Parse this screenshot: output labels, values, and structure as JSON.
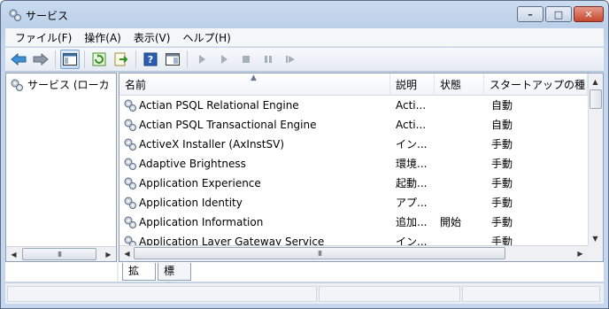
{
  "window": {
    "title": "サービス",
    "buttons": {
      "minimize": "–",
      "maximize": "□",
      "close": "✕"
    }
  },
  "menu": [
    {
      "label": "ファイル(F)"
    },
    {
      "label": "操作(A)"
    },
    {
      "label": "表示(V)"
    },
    {
      "label": "ヘルプ(H)"
    }
  ],
  "toolbar": {
    "icons": [
      "back-icon",
      "forward-icon",
      "show-hide-tree-icon",
      "refresh-icon",
      "export-list-icon",
      "help-icon",
      "properties-icon",
      "start-service-icon",
      "start-service-2-icon",
      "stop-service-icon",
      "pause-service-icon",
      "resume-service-icon"
    ]
  },
  "tree": {
    "item_label": "サービス (ローカ"
  },
  "list": {
    "columns": [
      {
        "label": "名前"
      },
      {
        "label": "説明"
      },
      {
        "label": "状態"
      },
      {
        "label": "スタートアップの種"
      }
    ],
    "rows": [
      {
        "name": "Actian PSQL Relational Engine",
        "desc": "Acti...",
        "status": "",
        "startup": "自動"
      },
      {
        "name": "Actian PSQL Transactional Engine",
        "desc": "Acti...",
        "status": "",
        "startup": "自動"
      },
      {
        "name": "ActiveX Installer (AxInstSV)",
        "desc": "イン...",
        "status": "",
        "startup": "手動"
      },
      {
        "name": "Adaptive Brightness",
        "desc": "環境...",
        "status": "",
        "startup": "手動"
      },
      {
        "name": "Application Experience",
        "desc": "起動...",
        "status": "",
        "startup": "手動"
      },
      {
        "name": "Application Identity",
        "desc": "アプ...",
        "status": "",
        "startup": "手動"
      },
      {
        "name": "Application Information",
        "desc": "追加...",
        "status": "開始",
        "startup": "手動"
      },
      {
        "name": "Application Layer Gateway Service",
        "desc": "イン...",
        "status": "",
        "startup": "手動"
      }
    ]
  },
  "scrollbars": {
    "grip": "III"
  },
  "tabs": [
    {
      "label": "拡張"
    },
    {
      "label": "標準"
    }
  ]
}
